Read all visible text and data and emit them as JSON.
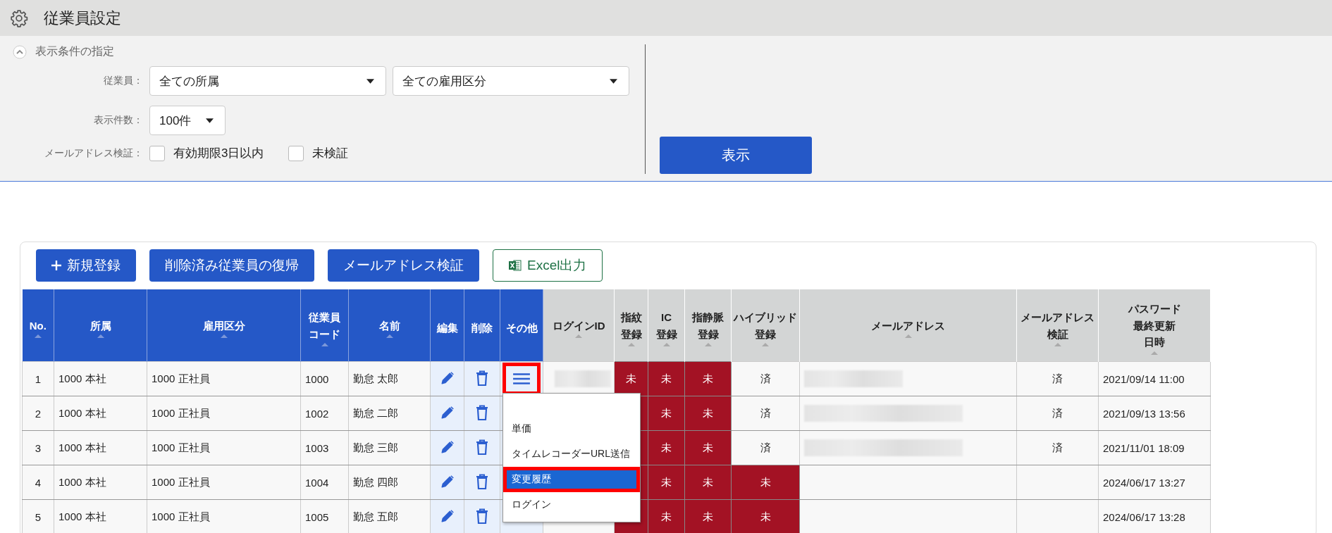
{
  "header": {
    "title": "従業員設定"
  },
  "filter": {
    "title": "表示条件の指定",
    "expanded": true,
    "rows": [
      {
        "kind": "selects",
        "label": "従業員：",
        "selects": [
          {
            "value": "全ての所属"
          },
          {
            "value": "全ての雇用区分"
          }
        ]
      },
      {
        "kind": "selects",
        "label": "表示件数：",
        "selects": [
          {
            "value": "100件"
          }
        ]
      },
      {
        "kind": "checkboxes",
        "label": "メールアドレス検証：",
        "checkboxes": [
          {
            "label": "有効期限3日以内",
            "checked": false
          },
          {
            "label": "未検証",
            "checked": false
          }
        ]
      }
    ],
    "submit": "表示"
  },
  "toolbar": [
    {
      "kind": "add",
      "label": "新規登録"
    },
    {
      "kind": "primary",
      "label": "削除済み従業員の復帰"
    },
    {
      "kind": "primary",
      "label": "メールアドレス検証"
    },
    {
      "kind": "excel",
      "label": "Excel出力"
    }
  ],
  "table": {
    "column_groups": [
      {
        "columns": [
          {
            "lines": [
              "No."
            ],
            "sortable": true
          },
          {
            "lines": [
              "所属"
            ],
            "sortable": true
          },
          {
            "lines": [
              "雇用区分"
            ],
            "sortable": true
          },
          {
            "lines": [
              "従業員",
              "コード"
            ],
            "sortable": true
          },
          {
            "lines": [
              "名前"
            ],
            "sortable": true
          },
          {
            "lines": [
              "編集"
            ],
            "sortable": false
          },
          {
            "lines": [
              "削除"
            ],
            "sortable": false
          },
          {
            "lines": [
              "その他"
            ],
            "sortable": false
          }
        ]
      },
      {
        "columns": [
          {
            "lines": [
              "ログインID"
            ],
            "sortable": true
          },
          {
            "lines": [
              "指紋",
              "登録"
            ],
            "sortable": true
          },
          {
            "lines": [
              "IC",
              "登録"
            ],
            "sortable": true
          },
          {
            "lines": [
              "指静脈",
              "登録"
            ],
            "sortable": true
          },
          {
            "lines": [
              "ハイブリッド",
              "登録"
            ],
            "sortable": true
          },
          {
            "lines": [
              "メールアドレス"
            ],
            "sortable": true
          },
          {
            "lines": [
              "メールアドレス",
              "検証"
            ],
            "sortable": true
          },
          {
            "lines": [
              "パスワード",
              "最終更新",
              "日時"
            ],
            "sortable": true
          }
        ]
      }
    ],
    "rows": [
      {
        "no": "1",
        "affiliation": "1000 本社",
        "employment": "1000 正社員",
        "code": "1000",
        "name": "勤怠 太郎",
        "menu_icon": true,
        "menu_outlined": true,
        "login_redacted": true,
        "registrations": [
          {
            "text": "未",
            "registered": false
          },
          {
            "text": "未",
            "registered": false
          },
          {
            "text": "未",
            "registered": false
          },
          {
            "text": "済",
            "registered": true
          }
        ],
        "email_redacted": true,
        "email_verification": "済",
        "password_updated": "2021/09/14 11:00"
      },
      {
        "no": "2",
        "affiliation": "1000 本社",
        "employment": "1000 正社員",
        "code": "1002",
        "name": "勤怠 二郎",
        "registrations": [
          {
            "registered": false
          },
          {
            "text": "未",
            "registered": false
          },
          {
            "text": "未",
            "registered": false
          },
          {
            "text": "済",
            "registered": true
          }
        ],
        "email_redacted": true,
        "email_verification": "済",
        "password_updated": "2021/09/13 13:56"
      },
      {
        "no": "3",
        "affiliation": "1000 本社",
        "employment": "1000 正社員",
        "code": "1003",
        "name": "勤怠 三郎",
        "registrations": [
          {
            "registered": false
          },
          {
            "text": "未",
            "registered": false
          },
          {
            "text": "未",
            "registered": false
          },
          {
            "text": "済",
            "registered": true
          }
        ],
        "email_redacted": true,
        "email_verification": "済",
        "password_updated": "2021/11/01 18:09"
      },
      {
        "no": "4",
        "affiliation": "1000 本社",
        "employment": "1000 正社員",
        "code": "1004",
        "name": "勤怠 四郎",
        "registrations": [
          {
            "registered": false
          },
          {
            "text": "未",
            "registered": false
          },
          {
            "text": "未",
            "registered": false
          },
          {
            "text": "未",
            "registered": false
          }
        ],
        "email_redacted": false,
        "password_updated": "2024/06/17 13:27"
      },
      {
        "no": "5",
        "affiliation": "1000 本社",
        "employment": "1000 正社員",
        "code": "1005",
        "name": "勤怠 五郎",
        "registrations": [
          {
            "registered": false
          },
          {
            "text": "未",
            "registered": false
          },
          {
            "text": "未",
            "registered": false
          },
          {
            "text": "未",
            "registered": false
          }
        ],
        "email_redacted": false,
        "password_updated": "2024/06/17 13:28"
      }
    ]
  },
  "menu": {
    "items": [
      {
        "label": "単価",
        "selected": false,
        "outlined": false
      },
      {
        "label": "タイムレコーダーURL送信",
        "selected": false,
        "outlined": false
      },
      {
        "label": "変更履歴",
        "selected": true,
        "outlined": true
      },
      {
        "label": "ログイン",
        "selected": false,
        "outlined": false
      }
    ]
  }
}
